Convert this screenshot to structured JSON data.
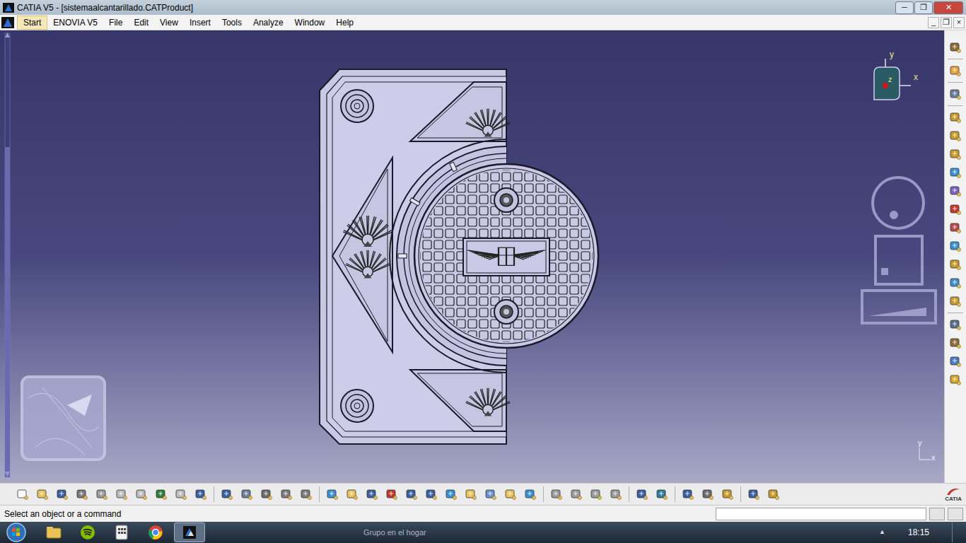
{
  "window": {
    "title": "CATIA V5 - [sistemaalcantarillado.CATProduct]",
    "controls": [
      "─",
      "❐",
      "✕"
    ]
  },
  "menu": {
    "items": [
      {
        "label": "Start",
        "selected": true
      },
      {
        "label": "ENOVIA V5",
        "selected": false
      },
      {
        "label": "File",
        "selected": false
      },
      {
        "label": "Edit",
        "selected": false
      },
      {
        "label": "View",
        "selected": false
      },
      {
        "label": "Insert",
        "selected": false
      },
      {
        "label": "Tools",
        "selected": false
      },
      {
        "label": "Analyze",
        "selected": false
      },
      {
        "label": "Window",
        "selected": false
      },
      {
        "label": "Help",
        "selected": false
      }
    ],
    "mdi_controls": [
      "_",
      "❐",
      "×"
    ]
  },
  "viewport": {
    "compass": {
      "axes": [
        "y",
        "z",
        "x"
      ]
    },
    "axis_indicator": {
      "axes": [
        "y",
        "x"
      ]
    }
  },
  "toolbar": {
    "logo": "CATIA"
  },
  "status_bar": {
    "prompt": "Select an object or a command",
    "input": ""
  },
  "taskbar": {
    "backdrop_text": "Grupo en el hogar",
    "tray_arrow": "▲",
    "time": "18:15",
    "apps": [
      {
        "kind": "explorer",
        "active": false
      },
      {
        "kind": "spotify",
        "active": false
      },
      {
        "kind": "calculator",
        "active": false
      },
      {
        "kind": "chrome",
        "active": false
      },
      {
        "kind": "catia",
        "active": true
      }
    ]
  }
}
